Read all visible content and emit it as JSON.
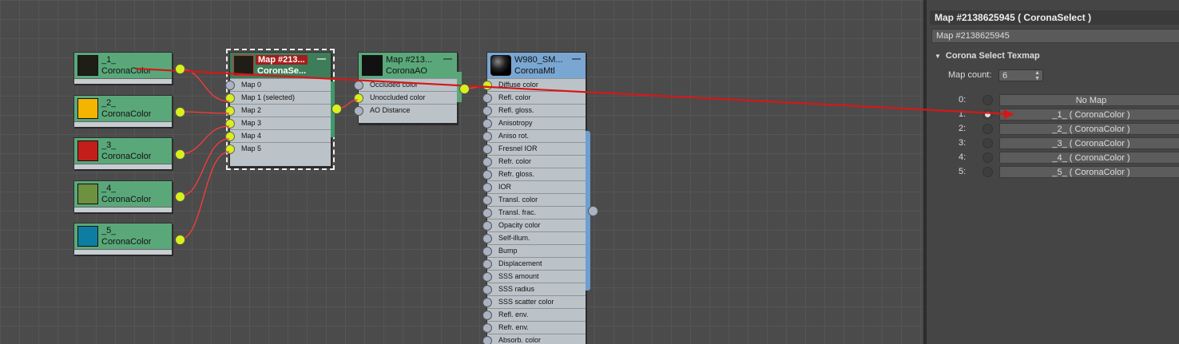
{
  "nodes": {
    "color1": {
      "title": "_1_",
      "type": "CoronaColor",
      "swatch": "#1e1e17"
    },
    "color2": {
      "title": "_2_",
      "type": "CoronaColor",
      "swatch": "#f4b400"
    },
    "color3": {
      "title": "_3_",
      "type": "CoronaColor",
      "swatch": "#c41e1a"
    },
    "color4": {
      "title": "_4_",
      "type": "CoronaColor",
      "swatch": "#6e9140"
    },
    "color5": {
      "title": "_5_",
      "type": "CoronaColor",
      "swatch": "#0d7ea1"
    },
    "select": {
      "title": "Map #213...",
      "type": "CoronaSe...",
      "slots": [
        "Map 0",
        "Map 1 (selected)",
        "Map 2",
        "Map 3",
        "Map 4",
        "Map 5"
      ]
    },
    "ao": {
      "title": "Map #213...",
      "type": "CoronaAO",
      "slots": [
        "Occluded color",
        "Unoccluded color",
        "AO Distance"
      ]
    },
    "mtl": {
      "title": "W980_SM...",
      "type": "CoronaMtl",
      "slots": [
        "Diffuse color",
        "Refl. color",
        "Refl. gloss.",
        "Anisotropy",
        "Aniso rot.",
        "Fresnel IOR",
        "Refr. color",
        "Refr. gloss.",
        "IOR",
        "Transl. color",
        "Transl. frac.",
        "Opacity color",
        "Self-illum.",
        "Bump",
        "Displacement",
        "SSS amount",
        "SSS radius",
        "SSS scatter color",
        "Refl. env.",
        "Refr. env.",
        "Absorb. color"
      ]
    }
  },
  "panel": {
    "title": "Map #2138625945  ( CoronaSelect )",
    "name_value": "Map #2138625945",
    "section": "Corona Select Texmap",
    "map_count_label": "Map count:",
    "map_count_value": "6",
    "maps": [
      {
        "index": "0:",
        "label": "No Map"
      },
      {
        "index": "1:",
        "label": "_1_  ( CoronaColor )"
      },
      {
        "index": "2:",
        "label": "_2_  ( CoronaColor )"
      },
      {
        "index": "3:",
        "label": "_3_  ( CoronaColor )"
      },
      {
        "index": "4:",
        "label": "_4_  ( CoronaColor )"
      },
      {
        "index": "5:",
        "label": "_5_  ( CoronaColor )"
      }
    ]
  },
  "colors": {
    "wire": "#ff3030",
    "arrow": "#dd1a1a",
    "accent": "#d8f01c"
  }
}
